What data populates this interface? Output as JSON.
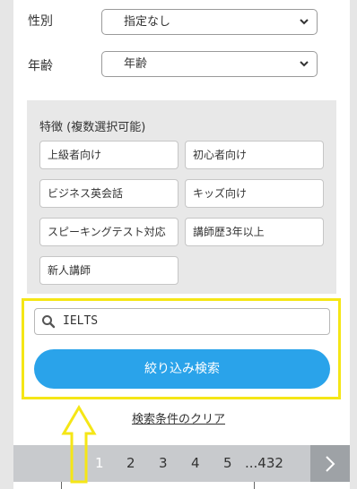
{
  "filters": {
    "gender": {
      "label": "性別",
      "value": "指定なし"
    },
    "age": {
      "label": "年齢",
      "value": "年齢"
    }
  },
  "features": {
    "title": "特徴 (複数選択可能)",
    "chips": [
      "上級者向け",
      "初心者向け",
      "ビジネス英会話",
      "キッズ向け",
      "スピーキングテスト対応",
      "講師歴3年以上",
      "新人講師"
    ]
  },
  "search": {
    "value": "IELTS",
    "button_label": "絞り込み検索"
  },
  "clear_label": "検索条件のクリア",
  "pagination": {
    "pages": [
      "1",
      "2",
      "3",
      "4",
      "5"
    ],
    "ellipsis_last": "...432",
    "current": "1"
  },
  "colors": {
    "accent": "#2aa3ea",
    "highlight": "#f5e616"
  },
  "icons": {
    "search": "search-icon",
    "select": "chevron-down-icon",
    "next": "chevron-right-icon",
    "annotation": "up-arrow-icon"
  }
}
